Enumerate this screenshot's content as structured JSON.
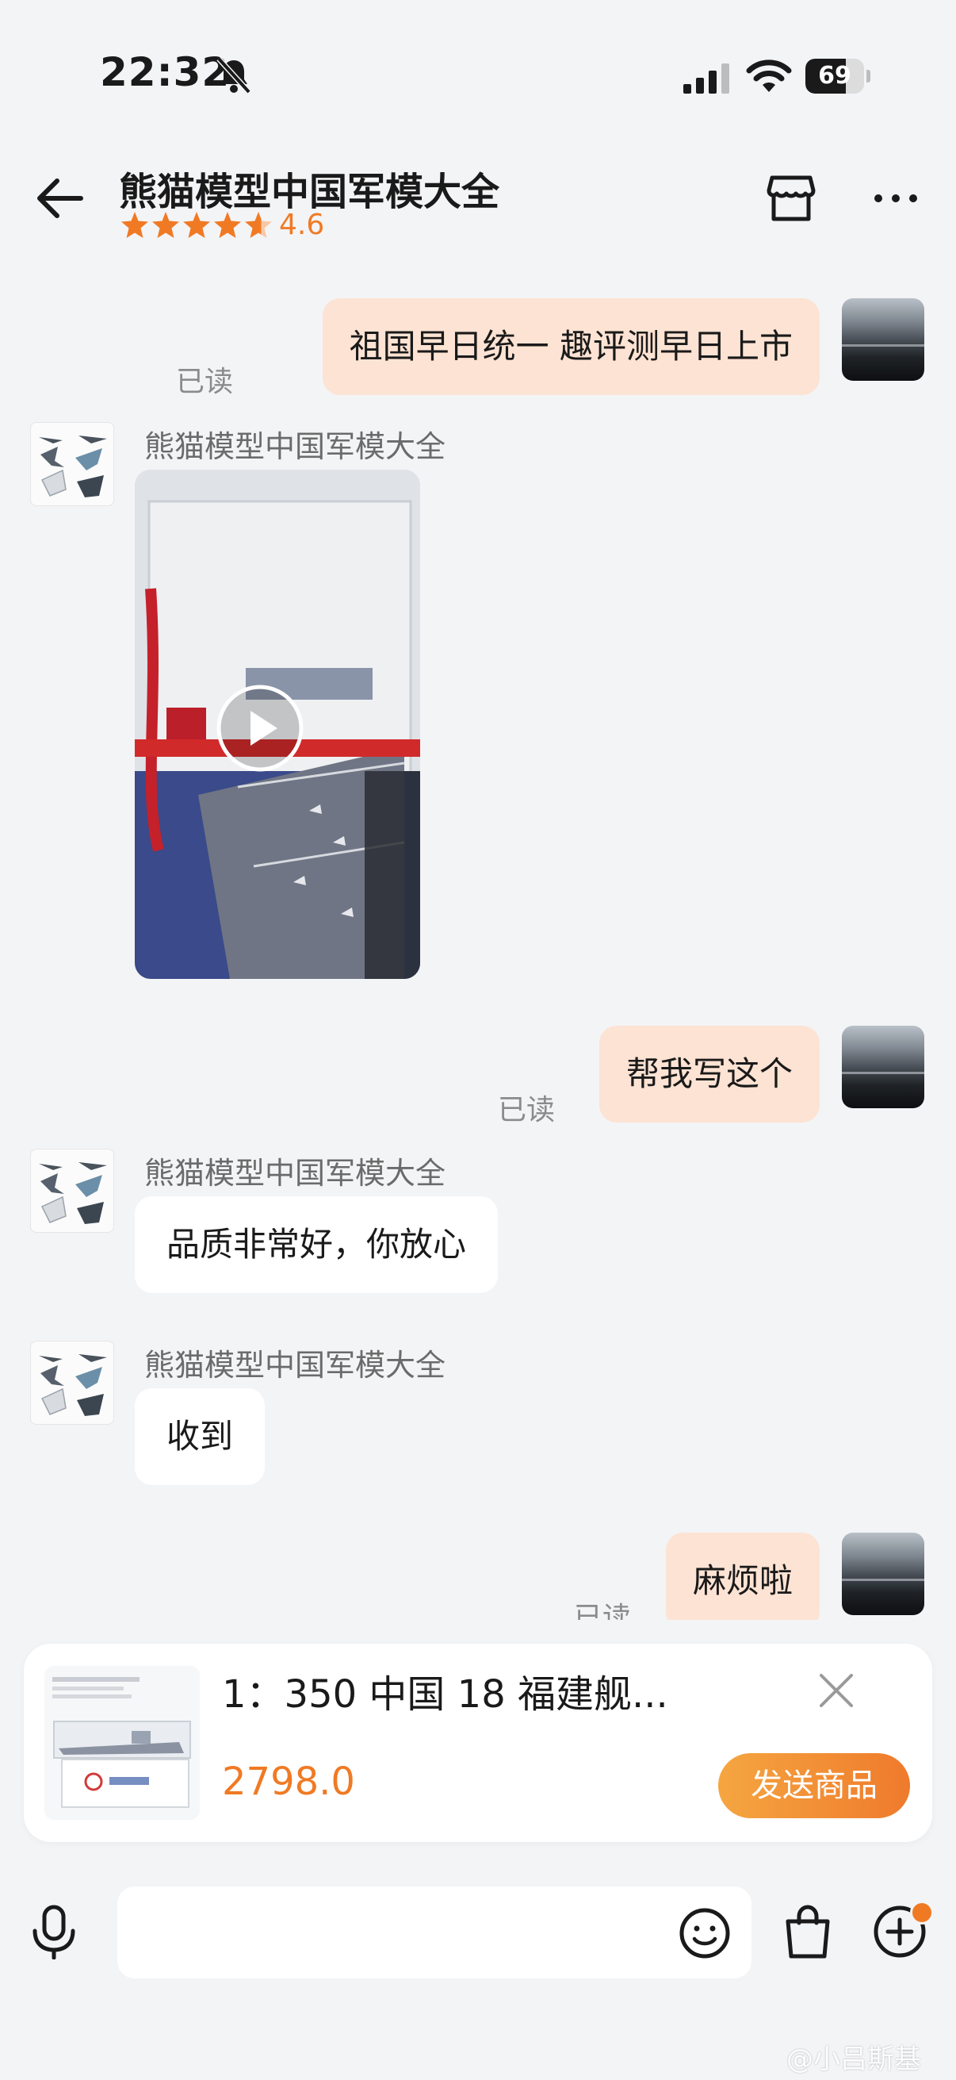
{
  "status_bar": {
    "time": "22:32",
    "battery": "69",
    "battery_level": 0.69
  },
  "header": {
    "title": "熊猫模型中国军模大全",
    "rating": "4.6",
    "rating_value": 4.6,
    "rating_max": 5
  },
  "messages": {
    "m1": {
      "text": "祖国早日统一  趣评测早日上市",
      "status": "已读"
    },
    "m2": {
      "sender": "熊猫模型中国军模大全"
    },
    "m3": {
      "text": "帮我写这个",
      "status": "已读"
    },
    "m4": {
      "sender": "熊猫模型中国军模大全",
      "text": "品质非常好，你放心"
    },
    "m5": {
      "sender": "熊猫模型中国军模大全",
      "text": "收到"
    },
    "m6": {
      "text": "麻烦啦",
      "status": "已读"
    }
  },
  "product_card": {
    "title": "1：350 中国 18 福建舰...",
    "price": "2798.0",
    "send_label": "发送商品"
  },
  "input": {
    "placeholder": ""
  },
  "watermark": "@小吕斯基",
  "colors": {
    "accent": "#f07a24",
    "my_bubble": "#fde3d3",
    "background": "#f3f4f6"
  },
  "icons": [
    "bell-muted-icon",
    "cellular-signal-icon",
    "wifi-icon",
    "back-arrow-icon",
    "star-icon",
    "store-icon",
    "more-icon",
    "play-icon",
    "close-icon",
    "microphone-icon",
    "emoji-icon",
    "shopping-bag-icon",
    "plus-icon"
  ]
}
